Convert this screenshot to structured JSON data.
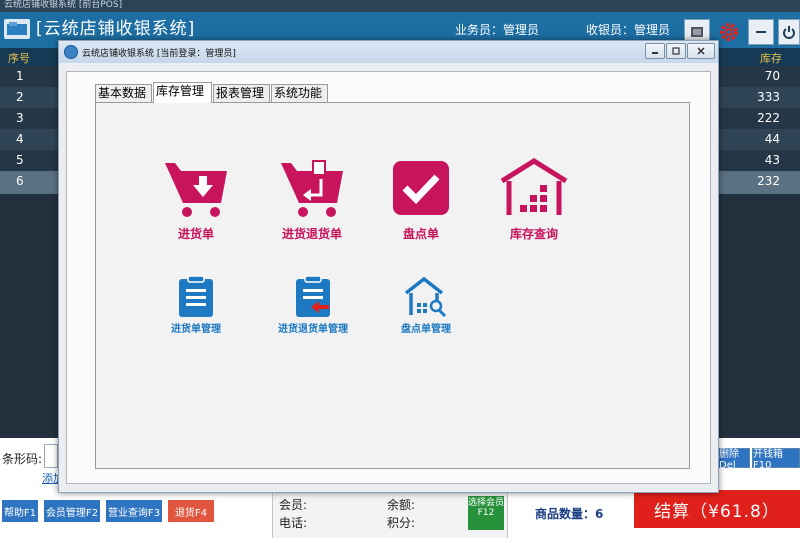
{
  "outer_window": {
    "title": "云统店铺收银系统 [前台POS]"
  },
  "banner": {
    "title": "[云统店铺收银系统]",
    "salesperson": "业务员：管理员",
    "cashier": "收银员：管理员"
  },
  "grid": {
    "col_seq": "序号",
    "col_stock": "库存",
    "rows": [
      {
        "seq": "1",
        "stock": "70"
      },
      {
        "seq": "2",
        "stock": "333"
      },
      {
        "seq": "3",
        "stock": "222"
      },
      {
        "seq": "4",
        "stock": "44"
      },
      {
        "seq": "5",
        "stock": "43"
      },
      {
        "seq": "6",
        "stock": "232"
      }
    ]
  },
  "bottom": {
    "barcode_label": "条形码:",
    "add_link": "添加",
    "del_btn": "删除Del",
    "open_drawer_btn": "开钱箱F10",
    "help_btn": "帮助F1",
    "member_mgmt_btn": "会员管理F2",
    "sales_query_btn": "营业查询F3",
    "return_btn": "退货F4",
    "member_label": "会员:",
    "phone_label": "电话:",
    "balance_label": "余额:",
    "points_label": "积分:",
    "choose_member_btn": "选择会员F12",
    "qty_label": "商品数量：6",
    "total_label": "结算（¥61.8）"
  },
  "dialog": {
    "title": "云统店铺收银系统 [当前登录：管理员]",
    "tabs": [
      "基本数据",
      "库存管理",
      "报表管理",
      "系统功能"
    ],
    "active_tab": "库存管理",
    "tiles_top": [
      "进货单",
      "进货退货单",
      "盘点单",
      "库存查询"
    ],
    "tiles_bottom": [
      "进货单管理",
      "进货退货单管理",
      "盘点单管理"
    ]
  },
  "colors": {
    "accent_pink": "#c8145d",
    "accent_blue": "#1d7ac2",
    "banner_blue": "#1d6ea3",
    "total_red": "#e0201a"
  },
  "icons": {
    "purchase": "cart-down-icon",
    "purchase_return": "cart-return-icon",
    "stocktake": "checkmark-icon",
    "stock_query": "warehouse-icon",
    "purchase_mgmt": "clipboard-icon",
    "return_mgmt": "clipboard-arrow-icon",
    "stocktake_mgmt": "house-search-icon"
  }
}
